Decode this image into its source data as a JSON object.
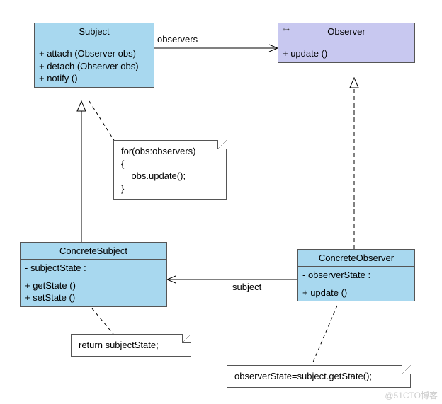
{
  "classes": {
    "subject": {
      "name": "Subject",
      "attributes": [],
      "operations": [
        "+ attach (Observer obs)",
        "+ detach (Observer obs)",
        "+ notify ()"
      ]
    },
    "observer": {
      "name": "Observer",
      "attributes": [],
      "operations": [
        "+ update ()"
      ]
    },
    "concreteSubject": {
      "name": "ConcreteSubject",
      "attributes": [
        "- subjectState :"
      ],
      "operations": [
        "+ getState ()",
        "+ setState ()"
      ]
    },
    "concreteObserver": {
      "name": "ConcreteObserver",
      "attributes": [
        "- observerState :"
      ],
      "operations": [
        "+ update ()"
      ]
    }
  },
  "notes": {
    "notifyLoop": "for(obs:observers)\n{\n    obs.update();\n}",
    "getState": "return subjectState;",
    "update": "observerState=subject.getState();"
  },
  "labels": {
    "observers": "observers",
    "subject": "subject"
  },
  "watermark": "@51CTO博客"
}
